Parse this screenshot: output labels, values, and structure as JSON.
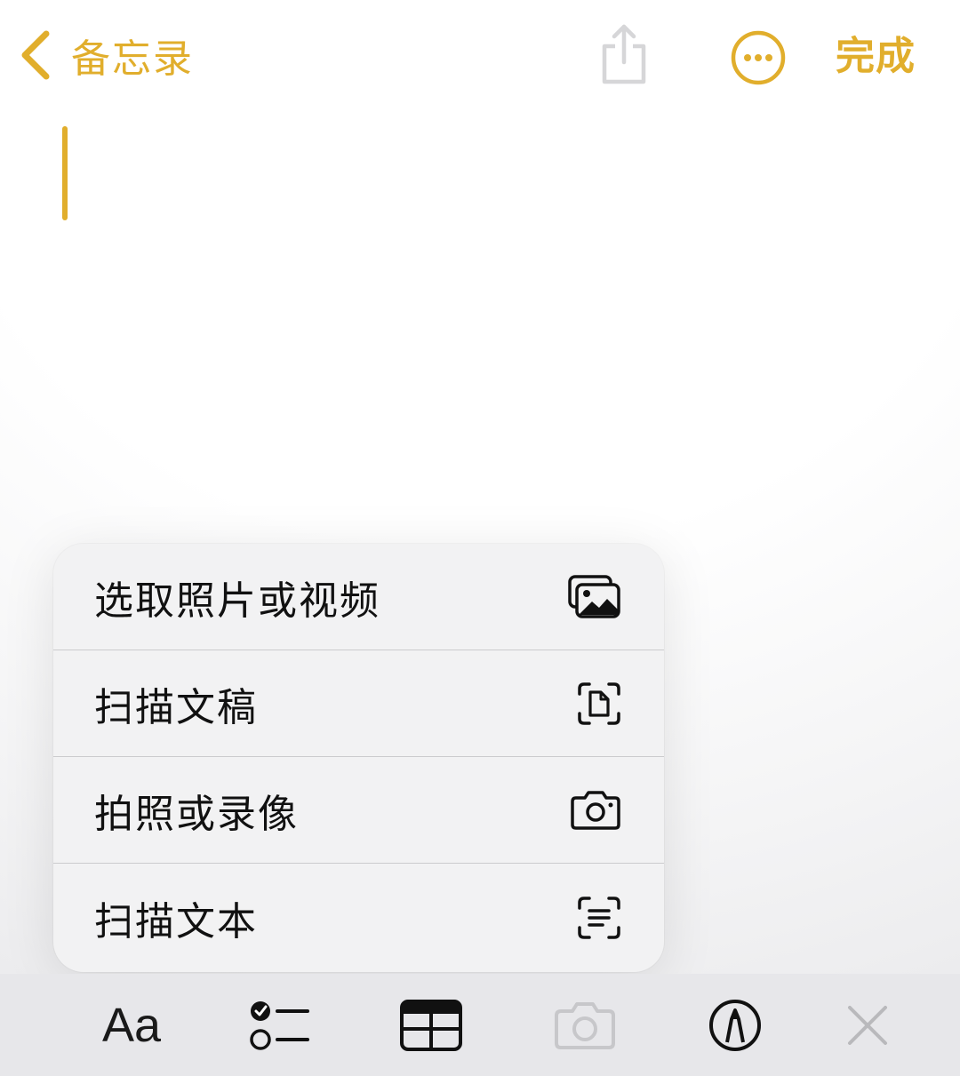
{
  "nav": {
    "back_label": "备忘录",
    "back_icon": "chevron-left-icon",
    "share_icon": "share-icon",
    "more_icon": "ellipsis-circle-icon",
    "done_label": "完成",
    "accent_color": "#E1AE2C"
  },
  "menu": {
    "items": [
      {
        "label": "选取照片或视频",
        "icon": "photo-library-icon"
      },
      {
        "label": "扫描文稿",
        "icon": "document-scan-icon"
      },
      {
        "label": "拍照或录像",
        "icon": "camera-icon"
      },
      {
        "label": "扫描文本",
        "icon": "text-scan-icon"
      }
    ]
  },
  "toolbar": {
    "format_label": "Aa",
    "checklist_icon": "checklist-icon",
    "table_icon": "table-icon",
    "camera_icon": "camera-icon",
    "markup_icon": "markup-pen-icon",
    "close_icon": "close-icon"
  }
}
